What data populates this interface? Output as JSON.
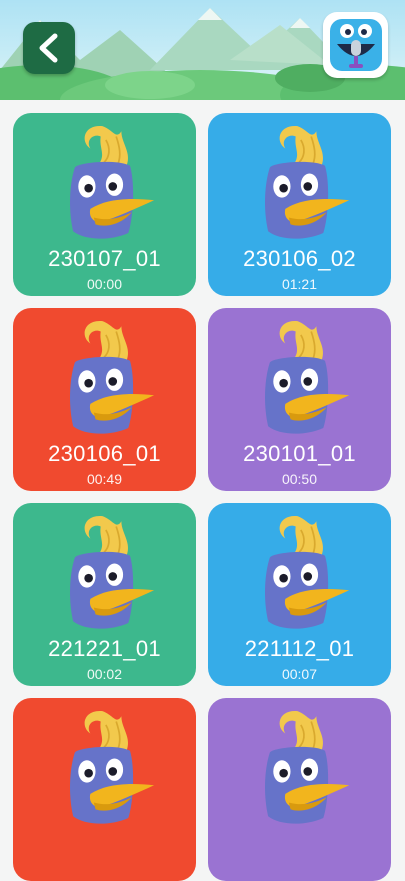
{
  "header": {
    "back_icon": "chevron-left-icon",
    "mascot_icon": "monster-microphone-icon"
  },
  "recordings": [
    {
      "name": "230107_01",
      "duration": "00:00",
      "color": "#3db88d"
    },
    {
      "name": "230106_02",
      "duration": "01:21",
      "color": "#36ace8"
    },
    {
      "name": "230106_01",
      "duration": "00:49",
      "color": "#f04a2f"
    },
    {
      "name": "230101_01",
      "duration": "00:50",
      "color": "#9a73d2"
    },
    {
      "name": "221221_01",
      "duration": "00:02",
      "color": "#3db88d"
    },
    {
      "name": "221112_01",
      "duration": "00:07",
      "color": "#36ace8"
    },
    {
      "name": "",
      "duration": "",
      "color": "#f04a2f"
    },
    {
      "name": "",
      "duration": "",
      "color": "#9a73d2"
    }
  ],
  "colors": {
    "green_card": "#3db88d",
    "blue_card": "#36ace8",
    "red_card": "#f04a2f",
    "purple_card": "#9a73d2",
    "back_button": "#1e6b44"
  }
}
